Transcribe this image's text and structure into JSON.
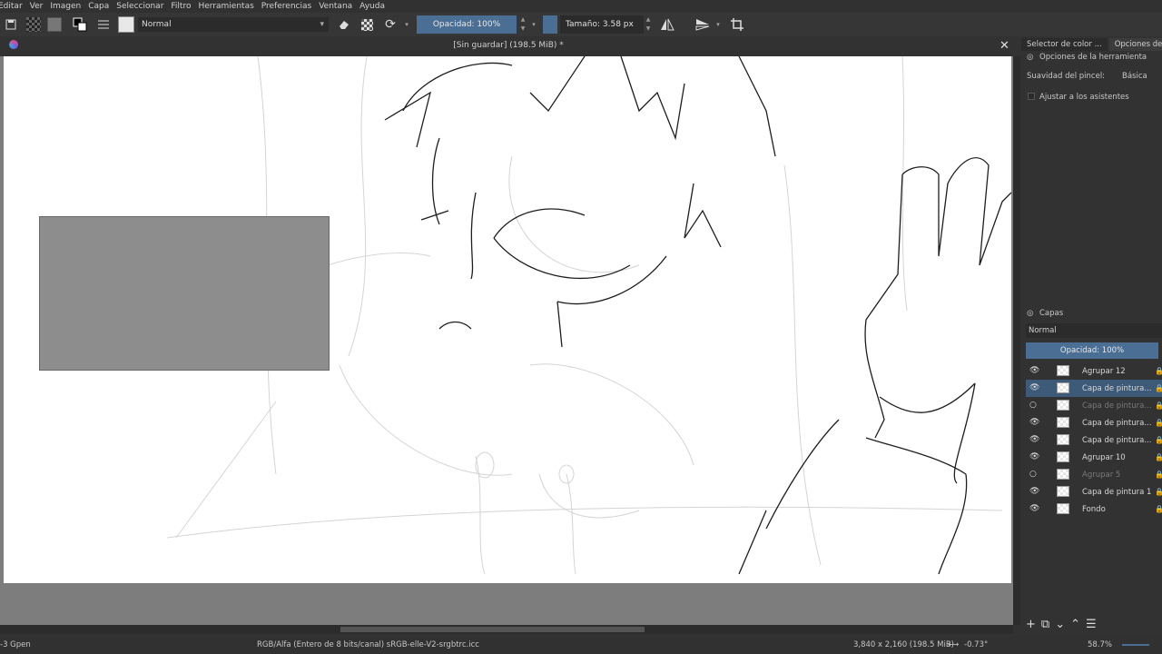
{
  "menu": [
    "Editar",
    "Ver",
    "Imagen",
    "Capa",
    "Seleccionar",
    "Filtro",
    "Herramientas",
    "Preferencias",
    "Ventana",
    "Ayuda"
  ],
  "toolbar": {
    "blend_mode": "Normal",
    "opacity": "Opacidad: 100%",
    "size": "Tamaño: 3.58 px"
  },
  "document": {
    "title": "[Sin guardar]  (198.5 MiB) *"
  },
  "dock": {
    "tabs": [
      "Selector de color ...",
      "Opciones de la"
    ],
    "tool_options_title": "Opciones de la herramienta",
    "brush_smoothing_label": "Suavidad del pincel:",
    "brush_smoothing_value": "Básica",
    "assistants_label": "Ajustar a los asistentes",
    "layers_title": "Capas",
    "layers_blend": "Normal",
    "layers_opacity": "Opacidad:  100%",
    "layers": [
      {
        "name": "Agrupar 12",
        "visible": true,
        "dim": false,
        "selected": false
      },
      {
        "name": "Capa de pintura...",
        "visible": true,
        "dim": false,
        "selected": true
      },
      {
        "name": "Capa de pintura...",
        "visible": false,
        "dim": true,
        "selected": false
      },
      {
        "name": "Capa de pintura...",
        "visible": true,
        "dim": false,
        "selected": false
      },
      {
        "name": "Capa de pintura...",
        "visible": true,
        "dim": false,
        "selected": false
      },
      {
        "name": "Agrupar 10",
        "visible": true,
        "dim": false,
        "selected": false
      },
      {
        "name": "Agrupar 5",
        "visible": false,
        "dim": true,
        "selected": false
      },
      {
        "name": "Capa de pintura 1",
        "visible": true,
        "dim": false,
        "selected": false
      },
      {
        "name": "Fondo",
        "visible": true,
        "dim": false,
        "selected": false
      }
    ]
  },
  "status": {
    "brush": "-3 Gpen",
    "color_space": "RGB/Alfa (Entero de 8 bits/canal)  sRGB-elle-V2-srgbtrc.icc",
    "dimensions": "3,840 x 2,160 (198.5 MiB)",
    "rotation": "-0.73°",
    "zoom": "58.7%"
  }
}
